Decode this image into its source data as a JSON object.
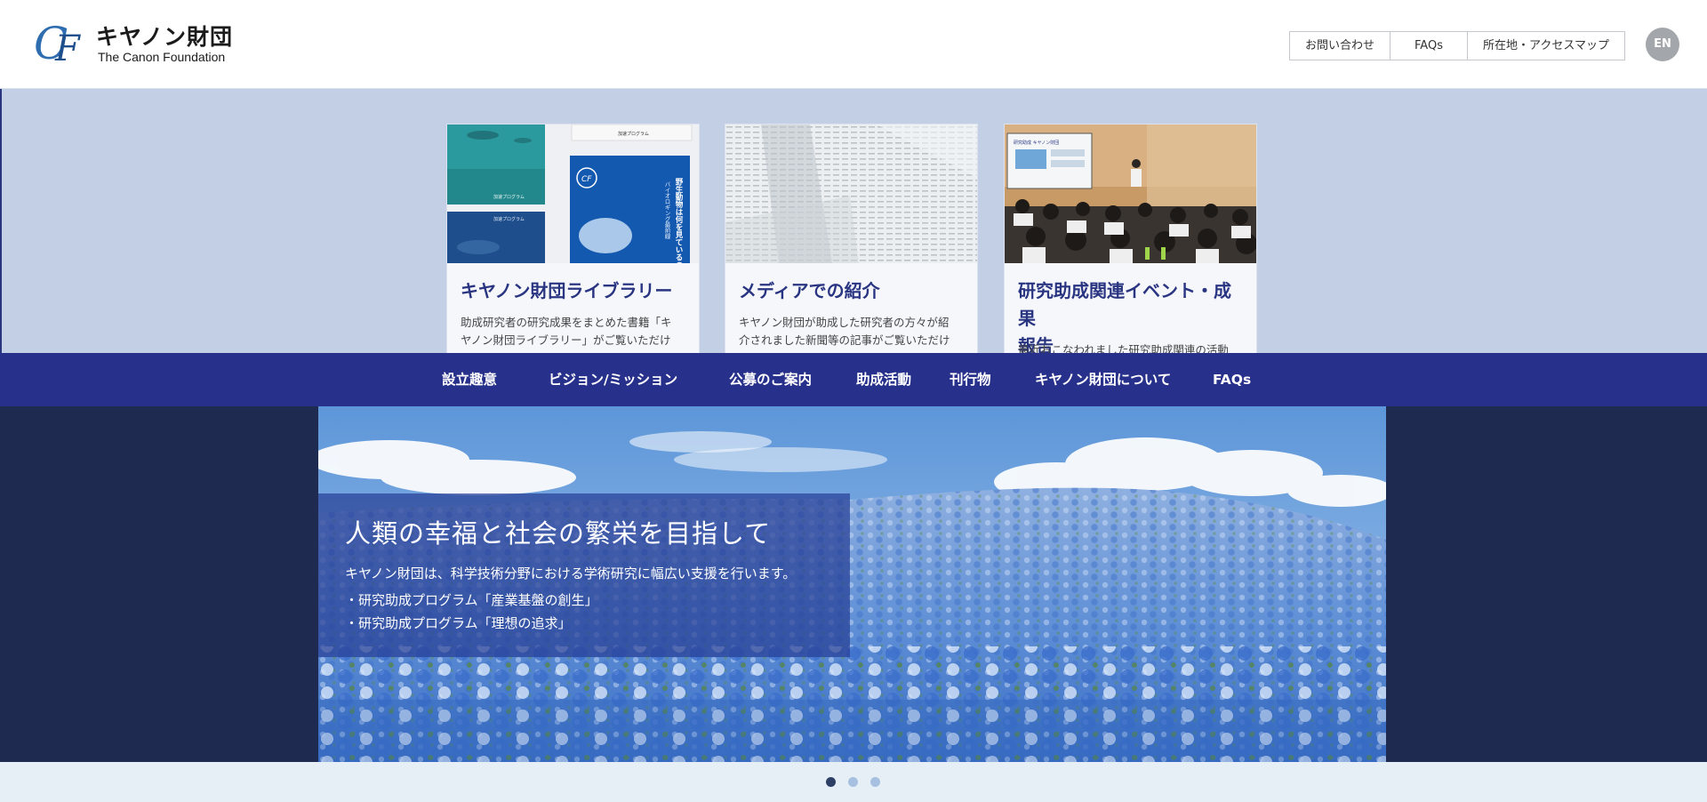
{
  "header": {
    "logo_ja": "キヤノン財団",
    "logo_en": "The Canon Foundation",
    "utility_links": [
      "お問い合わせ",
      "FAQs",
      "所在地・アクセスマップ"
    ],
    "language_button": "EN"
  },
  "cards": [
    {
      "title": "キヤノン財団ライブラリー",
      "text_line1": "助成研究者の研究成果をまとめた書籍「キ",
      "text_line2": "ヤノン財団ライブラリー」がご覧いただけ"
    },
    {
      "title": "メディアでの紹介",
      "text_line1": "キヤノン財団が助成した研究者の方々が紹",
      "text_line2": "介されました新聞等の記事がご覧いただけ"
    },
    {
      "title_line1": "研究助成関連イベント・成果",
      "title_line2": "報告",
      "text_line1": "最近おこなわれました研究助成関連の活動"
    }
  ],
  "book_covers": {
    "small_label_1": "加速プログラム",
    "small_label_2": "加速プログラム",
    "small_label_3": "加速プログラム",
    "vertical_title": "野生動物は何を見ているのか",
    "vertical_subtitle": "バイオロギング最前線"
  },
  "event_slide_title": "研究助成 キヤノン財団",
  "global_nav": [
    "設立趣意",
    "ビジョン/ミッション",
    "公募のご案内",
    "助成活動",
    "刊行物",
    "キヤノン財団について",
    "FAQs"
  ],
  "hero": {
    "heading": "人類の幸福と社会の繁栄を目指して",
    "description": "キヤノン財団は、科学技術分野における学術研究に幅広い支援を行います。",
    "bullet1": "・研究助成プログラム「産業基盤の創生」",
    "bullet2": "・研究助成プログラム「理想の追求」"
  },
  "pager": {
    "active_index": 0,
    "count": 3
  },
  "colors": {
    "accent": "#27308a",
    "band_light": "#c2cfe4",
    "hero_band": "#1e2a4f",
    "pager_band": "#e5eff5"
  }
}
